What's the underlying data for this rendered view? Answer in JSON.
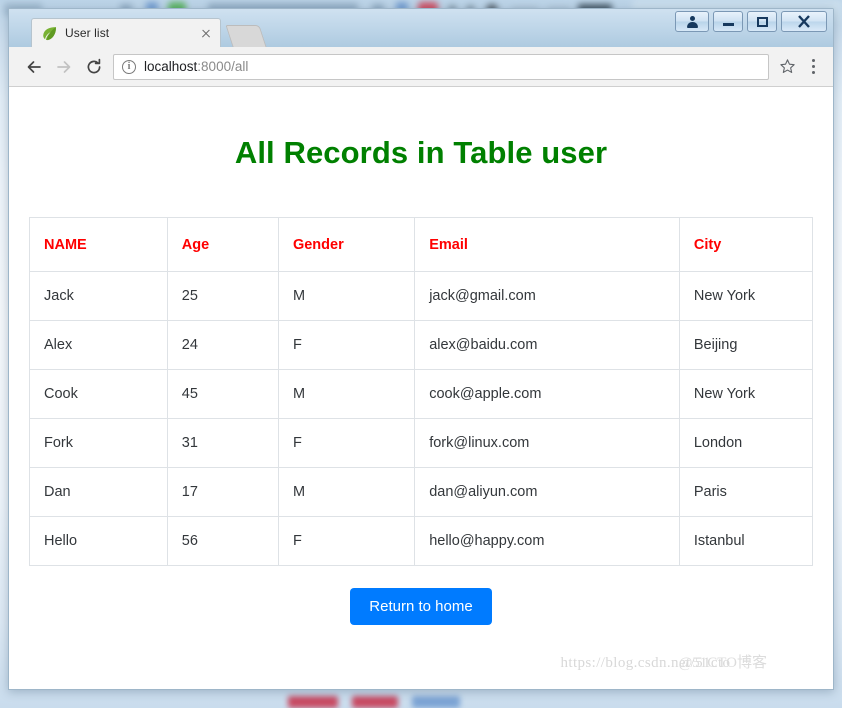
{
  "window": {
    "controls": {
      "user_label": "user-account-button",
      "minimize_label": "Minimize",
      "maximize_label": "Maximize",
      "close_label": "Close"
    }
  },
  "tab": {
    "title": "User list",
    "favicon": "green-leaf-icon",
    "close_label": "Close tab",
    "newtab_label": "New tab"
  },
  "toolbar": {
    "back_label": "Back",
    "forward_label": "Forward",
    "reload_label": "Reload",
    "site_info_icon": "info-circle-icon",
    "url_host": "localhost",
    "url_rest": ":8000/all",
    "url_full": "localhost:8000/all",
    "bookmark_icon": "star-icon",
    "menu_icon": "kebab-menu-icon"
  },
  "page": {
    "title": "All Records in Table user",
    "title_color": "#008000",
    "header_color": "#ff0000",
    "button": {
      "label": "Return to home",
      "color": "#007bff"
    },
    "watermark_url": "https://blog.csdn.net/51cto",
    "watermark_cn": "@51CTO博客"
  },
  "table": {
    "columns": [
      "NAME",
      "Age",
      "Gender",
      "Email",
      "City"
    ],
    "rows": [
      {
        "name": "Jack",
        "age": "25",
        "gender": "M",
        "email": "jack@gmail.com",
        "city": "New York"
      },
      {
        "name": "Alex",
        "age": "24",
        "gender": "F",
        "email": "alex@baidu.com",
        "city": "Beijing"
      },
      {
        "name": "Cook",
        "age": "45",
        "gender": "M",
        "email": "cook@apple.com",
        "city": "New York"
      },
      {
        "name": "Fork",
        "age": "31",
        "gender": "F",
        "email": "fork@linux.com",
        "city": "London"
      },
      {
        "name": "Dan",
        "age": "17",
        "gender": "M",
        "email": "dan@aliyun.com",
        "city": "Paris"
      },
      {
        "name": "Hello",
        "age": "56",
        "gender": "F",
        "email": "hello@happy.com",
        "city": "Istanbul"
      }
    ]
  }
}
